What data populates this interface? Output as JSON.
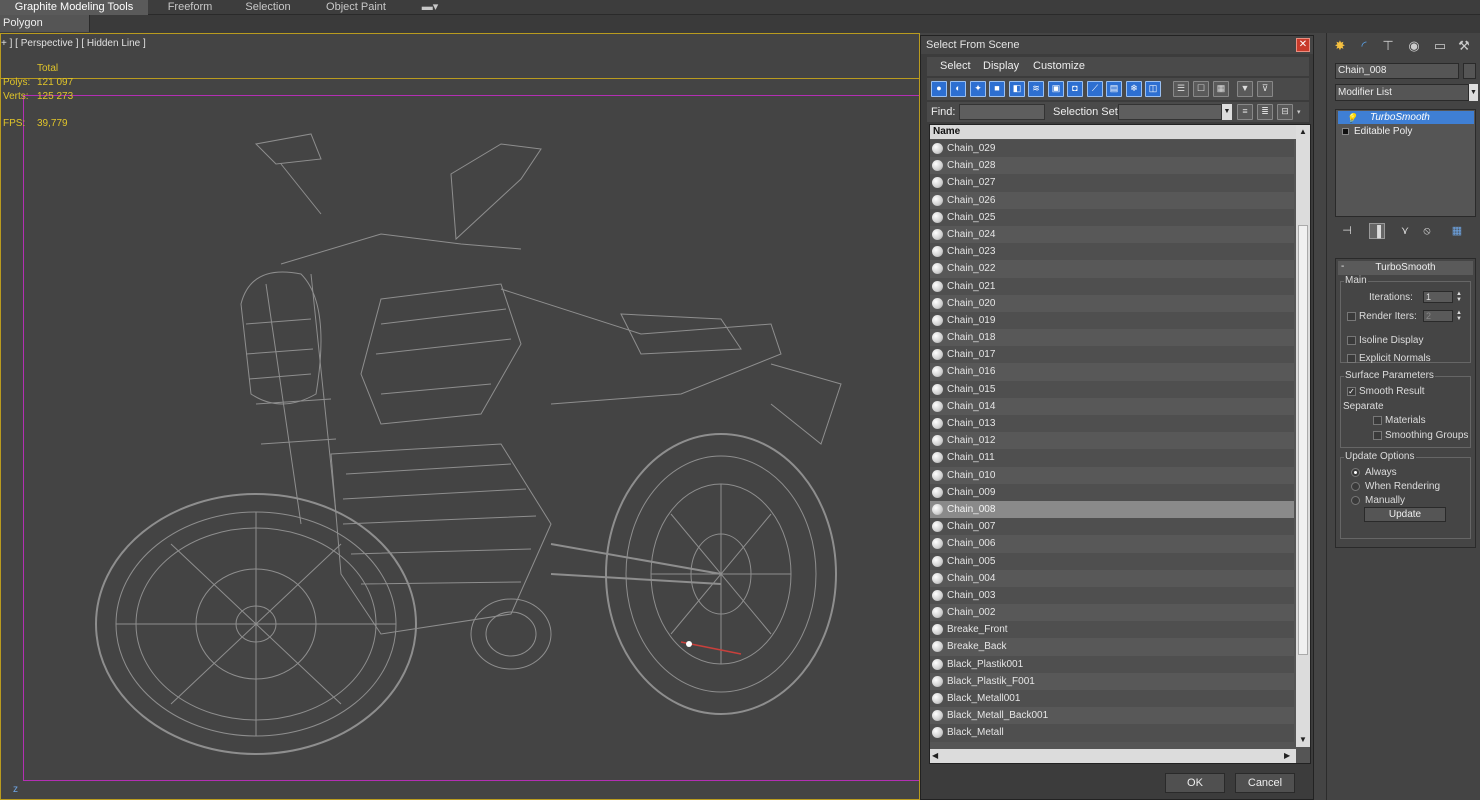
{
  "ribbon": {
    "tabs": [
      "Graphite Modeling Tools",
      "Freeform",
      "Selection",
      "Object Paint"
    ],
    "sub_tab": "Polygon Modeling"
  },
  "viewport": {
    "label": "+ ] [ Perspective ] [ Hidden Line ]",
    "stats": {
      "header": "Total",
      "polys_label": "Polys:",
      "polys_value": "121 097",
      "verts_label": "Verts:",
      "verts_value": "125 273",
      "fps_label": "FPS:",
      "fps_value": "39,779"
    },
    "axis_label": "z"
  },
  "dialog": {
    "title": "Select From Scene",
    "menus": [
      "Select",
      "Display",
      "Customize"
    ],
    "find_label": "Find:",
    "selection_set_label": "Selection Set:",
    "list_header": "Name",
    "items": [
      "Chain_029",
      "Chain_028",
      "Chain_027",
      "Chain_026",
      "Chain_025",
      "Chain_024",
      "Chain_023",
      "Chain_022",
      "Chain_021",
      "Chain_020",
      "Chain_019",
      "Chain_018",
      "Chain_017",
      "Chain_016",
      "Chain_015",
      "Chain_014",
      "Chain_013",
      "Chain_012",
      "Chain_011",
      "Chain_010",
      "Chain_009",
      "Chain_008",
      "Chain_007",
      "Chain_006",
      "Chain_005",
      "Chain_004",
      "Chain_003",
      "Chain_002",
      "Breake_Front",
      "Breake_Back",
      "Black_Plastik001",
      "Black_Plastik_F001",
      "Black_Metall001",
      "Black_Metall_Back001",
      "Black_Metall"
    ],
    "selected_item": "Chain_008",
    "ok_label": "OK",
    "cancel_label": "Cancel"
  },
  "command_panel": {
    "object_name": "Chain_008",
    "modifier_list": "Modifier List",
    "stack": [
      "TurboSmooth",
      "Editable Poly"
    ],
    "rollout": {
      "title": "TurboSmooth",
      "main_title": "Main",
      "iterations_label": "Iterations:",
      "iterations_value": "1",
      "render_iters_label": "Render Iters:",
      "render_iters_value": "2",
      "render_iters_checked": false,
      "isoline_label": "Isoline Display",
      "isoline_checked": false,
      "explicit_normals_label": "Explicit Normals",
      "explicit_normals_checked": false,
      "surface_title": "Surface Parameters",
      "smooth_result_label": "Smooth Result",
      "smooth_result_checked": true,
      "separate_label": "Separate",
      "materials_label": "Materials",
      "materials_checked": false,
      "smoothing_groups_label": "Smoothing Groups",
      "smoothing_groups_checked": false,
      "update_title": "Update Options",
      "always_label": "Always",
      "when_rendering_label": "When Rendering",
      "manually_label": "Manually",
      "update_mode": "Always",
      "update_button": "Update"
    }
  },
  "colors": {
    "viewport_border": "#b99b1f",
    "stats_text": "#e1c52a",
    "safe_frame": "#b42fb4",
    "selection_blue": "#3f7fd4",
    "wire": "#8e8e8e"
  }
}
